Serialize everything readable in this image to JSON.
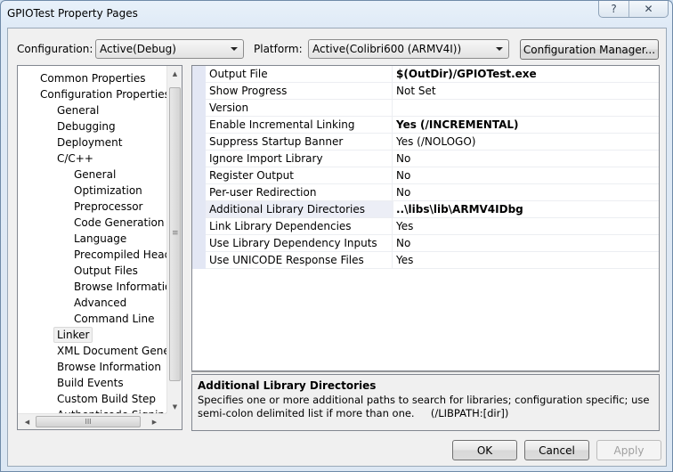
{
  "window": {
    "title": "GPIOTest Property Pages",
    "help_icon": "question-mark",
    "close_icon": "x"
  },
  "toolbar": {
    "configuration_label": "Configuration:",
    "configuration_value": "Active(Debug)",
    "platform_label": "Platform:",
    "platform_value": "Active(Colibri600 (ARMV4I))",
    "config_manager_label": "Configuration Manager..."
  },
  "tree": {
    "items": [
      {
        "label": "Common Properties",
        "level": 0
      },
      {
        "label": "Configuration Properties",
        "level": 0
      },
      {
        "label": "General",
        "level": 1
      },
      {
        "label": "Debugging",
        "level": 1
      },
      {
        "label": "Deployment",
        "level": 1
      },
      {
        "label": "C/C++",
        "level": 1
      },
      {
        "label": "General",
        "level": 2
      },
      {
        "label": "Optimization",
        "level": 2
      },
      {
        "label": "Preprocessor",
        "level": 2
      },
      {
        "label": "Code Generation",
        "level": 2
      },
      {
        "label": "Language",
        "level": 2
      },
      {
        "label": "Precompiled Headers",
        "level": 2
      },
      {
        "label": "Output Files",
        "level": 2
      },
      {
        "label": "Browse Information",
        "level": 2
      },
      {
        "label": "Advanced",
        "level": 2
      },
      {
        "label": "Command Line",
        "level": 2
      },
      {
        "label": "Linker",
        "level": 1,
        "selected": true
      },
      {
        "label": "XML Document Generator",
        "level": 1
      },
      {
        "label": "Browse Information",
        "level": 1
      },
      {
        "label": "Build Events",
        "level": 1
      },
      {
        "label": "Custom Build Step",
        "level": 1
      },
      {
        "label": "Authenticode Signing",
        "level": 1
      }
    ],
    "hscroll_grip": "III",
    "vscroll_grip": "≡"
  },
  "properties": {
    "rows": [
      {
        "name": "Output File",
        "value": "$(OutDir)/GPIOTest.exe",
        "bold": true
      },
      {
        "name": "Show Progress",
        "value": "Not Set",
        "bold": false
      },
      {
        "name": "Version",
        "value": "",
        "bold": false
      },
      {
        "name": "Enable Incremental Linking",
        "value": "Yes (/INCREMENTAL)",
        "bold": true
      },
      {
        "name": "Suppress Startup Banner",
        "value": "Yes (/NOLOGO)",
        "bold": false
      },
      {
        "name": "Ignore Import Library",
        "value": "No",
        "bold": false
      },
      {
        "name": "Register Output",
        "value": "No",
        "bold": false
      },
      {
        "name": "Per-user Redirection",
        "value": "No",
        "bold": false
      },
      {
        "name": "Additional Library Directories",
        "value": "..\\libs\\lib\\ARMV4IDbg",
        "bold": true,
        "selected": true
      },
      {
        "name": "Link Library Dependencies",
        "value": "Yes",
        "bold": false
      },
      {
        "name": "Use Library Dependency Inputs",
        "value": "No",
        "bold": false
      },
      {
        "name": "Use UNICODE Response Files",
        "value": "Yes",
        "bold": false
      }
    ]
  },
  "description": {
    "title": "Additional Library Directories",
    "line1": "Specifies one or more additional paths to search for libraries; configuration specific; use",
    "line2": "semi-colon delimited list if more than one.     (/LIBPATH:[dir])"
  },
  "buttons": {
    "ok": "OK",
    "cancel": "Cancel",
    "apply": "Apply"
  }
}
